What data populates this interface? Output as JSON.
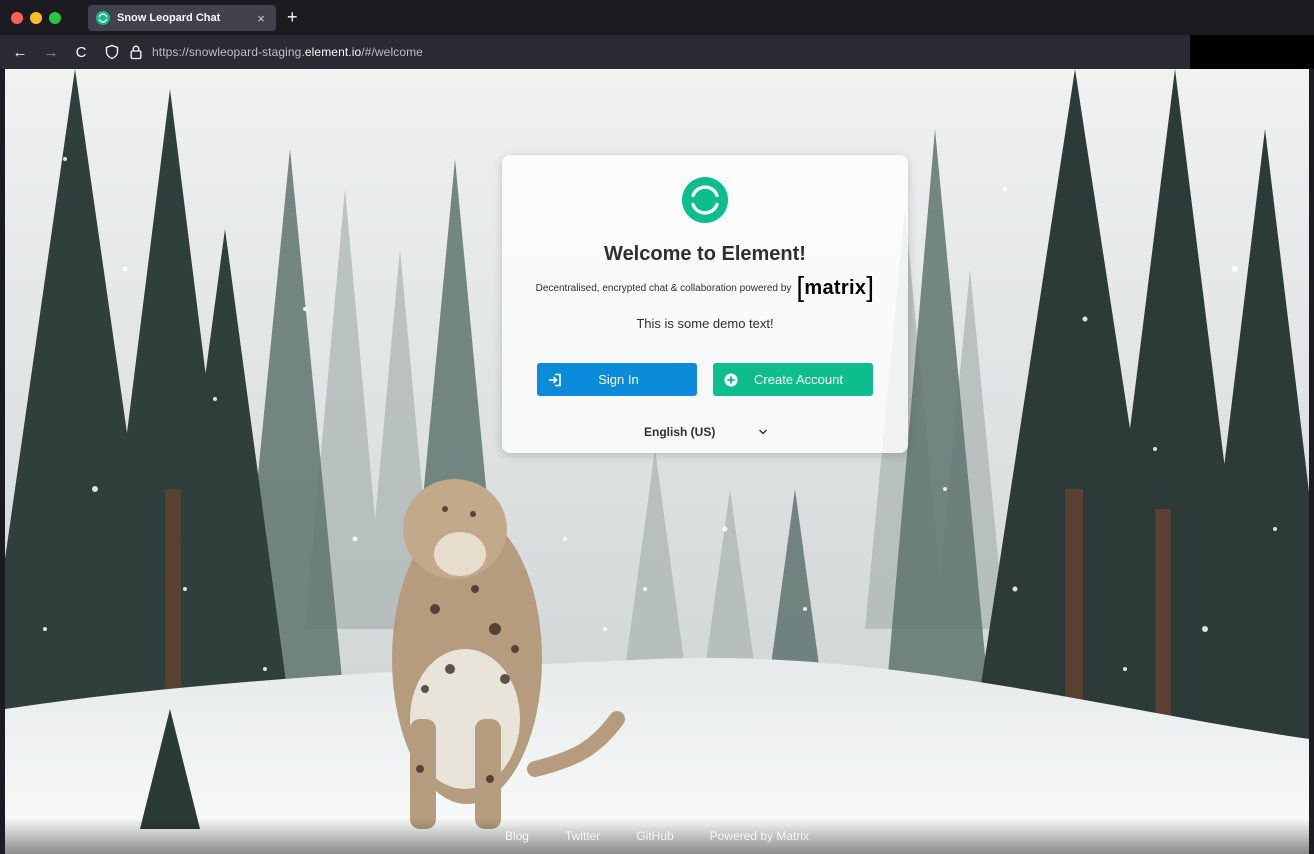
{
  "browser": {
    "tab_title": "Snow Leopard Chat",
    "tab_close": "×",
    "new_tab": "+",
    "url_prefix": "https://snowleopard-staging.",
    "url_domain": "element.io",
    "url_suffix": "/#/welcome"
  },
  "auth": {
    "title": "Welcome to Element!",
    "tagline": "Decentralised, encrypted chat & collaboration powered by",
    "matrix_word": "matrix",
    "demo_text": "This is some demo text!",
    "sign_in_label": "Sign In",
    "create_account_label": "Create Account",
    "language": "English (US)"
  },
  "footer": {
    "links": [
      "Blog",
      "Twitter",
      "GitHub",
      "Powered by Matrix"
    ]
  },
  "colors": {
    "element_green": "#0dbd8b",
    "sign_in_blue": "#0b8bd9",
    "browser_bg": "#1c1b22"
  },
  "icons": {
    "tab_favicon": "element-logo-icon",
    "card_logo": "element-logo-icon",
    "sign_in": "sign-in-icon",
    "create_account": "plus-circle-icon",
    "language": "chevron-down-icon"
  }
}
